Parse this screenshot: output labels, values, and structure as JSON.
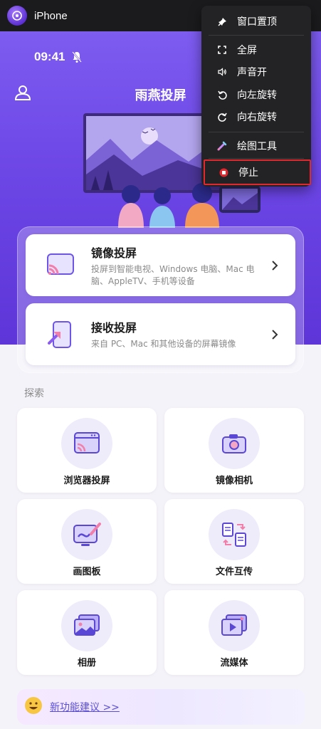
{
  "window": {
    "title": "iPhone"
  },
  "status_bar": {
    "time": "09:41"
  },
  "header": {
    "title": "雨燕投屏"
  },
  "features": [
    {
      "title": "镜像投屏",
      "desc": "投屏到智能电视、Windows 电脑、Mac 电脑、AppleTV、手机等设备"
    },
    {
      "title": "接收投屏",
      "desc": "来自 PC、Mac 和其他设备的屏幕镜像"
    }
  ],
  "explore": {
    "title": "探索",
    "tiles": [
      {
        "label": "浏览器投屏"
      },
      {
        "label": "镜像相机"
      },
      {
        "label": "画图板"
      },
      {
        "label": "文件互传"
      },
      {
        "label": "相册"
      },
      {
        "label": "流媒体"
      }
    ]
  },
  "suggestion": {
    "link": "新功能建议 >>"
  },
  "context_menu": {
    "items": [
      {
        "label": "窗口置顶",
        "icon": "pin-icon"
      },
      {
        "label": "全屏",
        "icon": "fullscreen-icon"
      },
      {
        "label": "声音开",
        "icon": "speaker-icon"
      },
      {
        "label": "向左旋转",
        "icon": "rotate-left-icon"
      },
      {
        "label": "向右旋转",
        "icon": "rotate-right-icon"
      },
      {
        "label": "绘图工具",
        "icon": "pen-icon"
      },
      {
        "label": "停止",
        "icon": "stop-icon"
      }
    ]
  },
  "colors": {
    "accent": "#6d46e6",
    "stop_highlight": "#e0282e",
    "menu_bg": "#232325"
  }
}
